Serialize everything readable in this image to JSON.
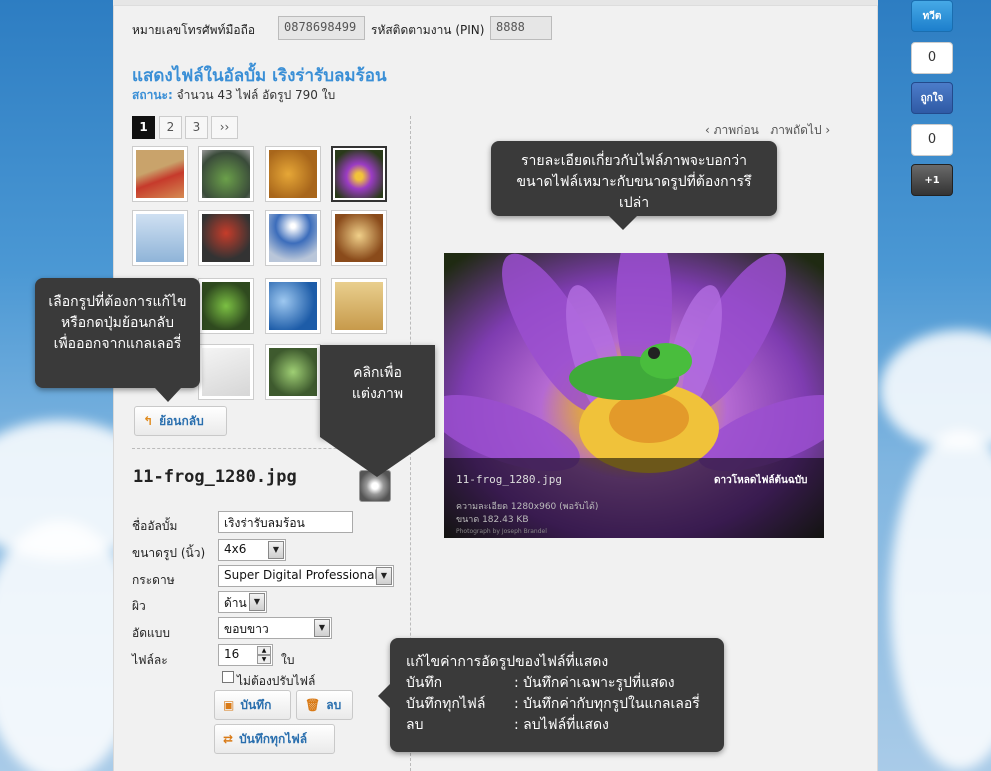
{
  "phone": {
    "label": "หมายเลขโทรศัพท์มือถือ",
    "value": "0878698499",
    "pin_label": "รหัสติดตามงาน (PIN)",
    "pin_value": "8888"
  },
  "album": {
    "title": "แสดงไฟล์ในอัลบั้ม เริงร่ารับลมร้อน",
    "status_label": "สถานะ:",
    "status_text": "จำนวน 43 ไฟล์ อัดรูป 790 ใบ"
  },
  "pagination": {
    "pages": [
      "1",
      "2",
      "3"
    ],
    "next": "››"
  },
  "back_button": "ย้อนกลับ",
  "file": {
    "name": "11-frog_1280.jpg"
  },
  "form": {
    "album_name_label": "ชื่ออัลบั้ม",
    "album_name_value": "เริงร่ารับลมร้อน",
    "size_label": "ขนาดรูป (นิ้ว)",
    "size_value": "4x6",
    "paper_label": "กระดาษ",
    "paper_value": "Super Digital Professional",
    "surface_label": "ผิว",
    "surface_value": "ด้าน",
    "border_label": "อัดแบบ",
    "border_value": "ขอบขาว",
    "per_file_label": "ไฟล์ละ",
    "per_file_value": "16",
    "per_file_unit": "ใบ",
    "no_adjust_label": "ไม่ต้องปรับไฟล์"
  },
  "buttons": {
    "save": "บันทึก",
    "delete": "ลบ",
    "save_all": "บันทึกทุกไฟล์"
  },
  "nav": {
    "prev": "‹ ภาพก่อน",
    "next": "ภาพถัดไป ›"
  },
  "preview": {
    "filename": "11-frog_1280.jpg",
    "download": "ดาวโหลดไฟล์ต้นฉบับ",
    "resolution": "ความละเอียด 1280x960 (พอรับได้)",
    "size": "ขนาด 182.43 KB",
    "credit": "Photograph by Joseph Brandel"
  },
  "tips": {
    "top_line1": "รายละเอียดเกี่ยวกับไฟล์ภาพจะบอกว่า",
    "top_line2": "ขนาดไฟล์เหมาะกับขนาดรูปที่ต้องการรึเปล่า",
    "left_line1": "เลือกรูปที่ต้องการแก้ไข",
    "left_line2": "หรือกดปุ่มย้อนกลับ",
    "left_line3": "เพื่อออกจากแกลเลอรี่",
    "edit_line1": "คลิกเพื่อ",
    "edit_line2": "แต่งภาพ",
    "bottom_title": "แก้ไขค่าการอัดรูปของไฟล์ที่แสดง",
    "rows": [
      {
        "key": "บันทึก",
        "val": ": บันทึกค่าเฉพาะรูปที่แสดง"
      },
      {
        "key": "บันทึกทุกไฟล์",
        "val": ": บันทึกค่ากับทุกรูปในแกลเลอรี่"
      },
      {
        "key": "ลบ",
        "val": ": ลบไฟล์ที่แสดง"
      }
    ]
  },
  "side": {
    "tweet": "ทวีต",
    "tweet_count": "0",
    "like": "ถูกใจ",
    "like_count": "0",
    "plus": "+1"
  }
}
